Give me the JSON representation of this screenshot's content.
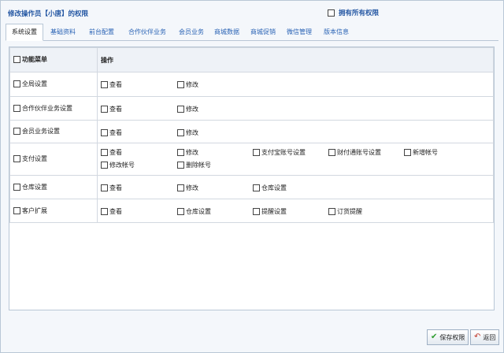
{
  "header": {
    "title": "修改操作员【小唐】的权限",
    "own_all_label": "拥有所有权限"
  },
  "tabs": [
    "系统设置",
    "基础资料",
    "前台配置",
    "合作伙伴业务",
    "会员业务",
    "商城数据",
    "商城促销",
    "微信管理",
    "版本信息"
  ],
  "active_tab": "系统设置",
  "table": {
    "header_menu": "功能菜单",
    "header_ops": "操作",
    "rows": [
      {
        "menu": "全局设置",
        "ops": [
          "查看",
          "修改"
        ]
      },
      {
        "menu": "合作伙伴业务设置",
        "ops": [
          "查看",
          "修改"
        ]
      },
      {
        "menu": "会员业务设置",
        "ops": [
          "查看",
          "修改"
        ]
      },
      {
        "menu": "支付设置",
        "ops": [
          "查看",
          "修改",
          "支付宝账号设置",
          "财付通账号设置",
          "新增帐号",
          "修改帐号",
          "删除帐号"
        ]
      },
      {
        "menu": "仓库设置",
        "ops": [
          "查看",
          "修改",
          "仓库设置"
        ]
      },
      {
        "menu": "客户扩展",
        "ops": [
          "查看",
          "仓库设置",
          "提醒设置",
          "订货提醒"
        ]
      }
    ]
  },
  "buttons": {
    "save": "保存权限",
    "back": "返回"
  },
  "colors": {
    "title_blue": "#2457a3",
    "tab_link_blue": "#2a63b5",
    "border": "#b9c7d6"
  }
}
